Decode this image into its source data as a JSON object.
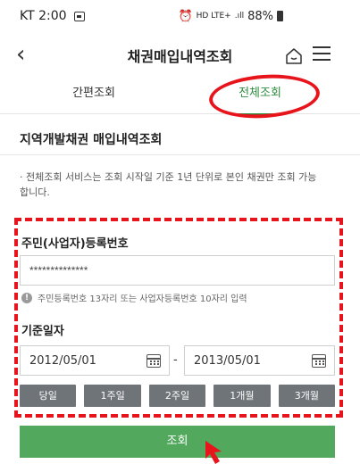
{
  "status_bar": {
    "carrier_time": "KT 2:00",
    "network": "HD LTE+",
    "signal": ".ıll",
    "battery": "88%"
  },
  "header": {
    "title": "채권매입내역조회"
  },
  "tabs": [
    {
      "label": "간편조회",
      "active": false
    },
    {
      "label": "전체조회",
      "active": true
    }
  ],
  "section": {
    "title": "지역개발채권 매입내역조회",
    "notice": "· 전체조회 서비스는 조회 시작일 기준 1년 단위로 본인 채권만 조회 가능합니다."
  },
  "form": {
    "id_label": "주민(사업자)등록번호",
    "id_value": "**************",
    "hint": "주민등록번호 13자리 또는 사업자등록번호 10자리 입력",
    "date_label": "기준일자",
    "date_from": "2012/05/01",
    "date_sep": "-",
    "date_to": "2013/05/01",
    "periods": [
      "당일",
      "1주일",
      "2주일",
      "1개월",
      "3개월"
    ],
    "submit_label": "조회"
  },
  "colors": {
    "accent_green": "#2e8b3e",
    "button_green": "#52a95d",
    "period_gray": "#6f7478",
    "annotation_red": "#e8141b"
  }
}
